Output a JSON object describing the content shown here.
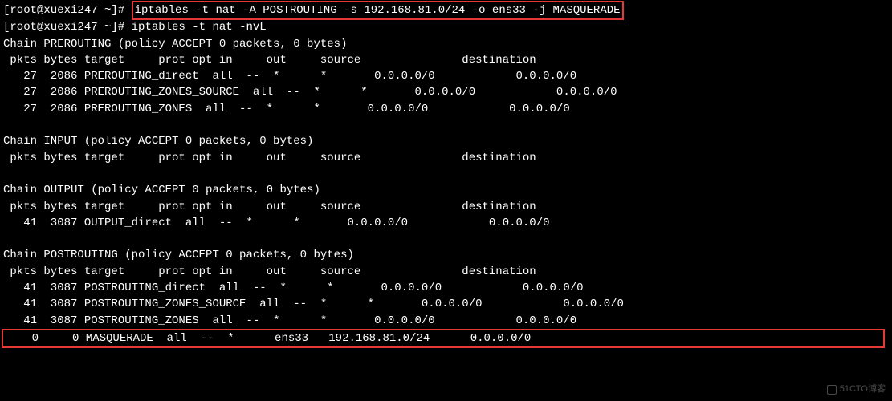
{
  "prompt1": "[root@xuexi247 ~]# ",
  "cmd1": "iptables -t nat -A POSTROUTING -s 192.168.81.0/24 -o ens33 -j MASQUERADE",
  "prompt2": "[root@xuexi247 ~]# ",
  "cmd2": "iptables -t nat -nvL",
  "chain_prerouting_header": "Chain PREROUTING (policy ACCEPT 0 packets, 0 bytes)",
  "columns_header1": " pkts bytes target     prot opt in     out     source               destination",
  "prerouting_rules": [
    "   27  2086 PREROUTING_direct  all  --  *      *       0.0.0.0/0            0.0.0.0/0",
    "   27  2086 PREROUTING_ZONES_SOURCE  all  --  *      *       0.0.0.0/0            0.0.0.0/0",
    "   27  2086 PREROUTING_ZONES  all  --  *      *       0.0.0.0/0            0.0.0.0/0"
  ],
  "chain_input_header": "Chain INPUT (policy ACCEPT 0 packets, 0 bytes)",
  "columns_header2": " pkts bytes target     prot opt in     out     source               destination",
  "chain_output_header": "Chain OUTPUT (policy ACCEPT 0 packets, 0 bytes)",
  "columns_header3": " pkts bytes target     prot opt in     out     source               destination",
  "output_rules": [
    "   41  3087 OUTPUT_direct  all  --  *      *       0.0.0.0/0            0.0.0.0/0"
  ],
  "chain_postrouting_header": "Chain POSTROUTING (policy ACCEPT 0 packets, 0 bytes)",
  "columns_header4": " pkts bytes target     prot opt in     out     source               destination",
  "postrouting_rules": [
    "   41  3087 POSTROUTING_direct  all  --  *      *       0.0.0.0/0            0.0.0.0/0",
    "   41  3087 POSTROUTING_ZONES_SOURCE  all  --  *      *       0.0.0.0/0            0.0.0.0/0",
    "   41  3087 POSTROUTING_ZONES  all  --  *      *       0.0.0.0/0            0.0.0.0/0"
  ],
  "masquerade_rule": "    0     0 MASQUERADE  all  --  *      ens33   192.168.81.0/24      0.0.0.0/0",
  "watermark": "51CTO博客"
}
